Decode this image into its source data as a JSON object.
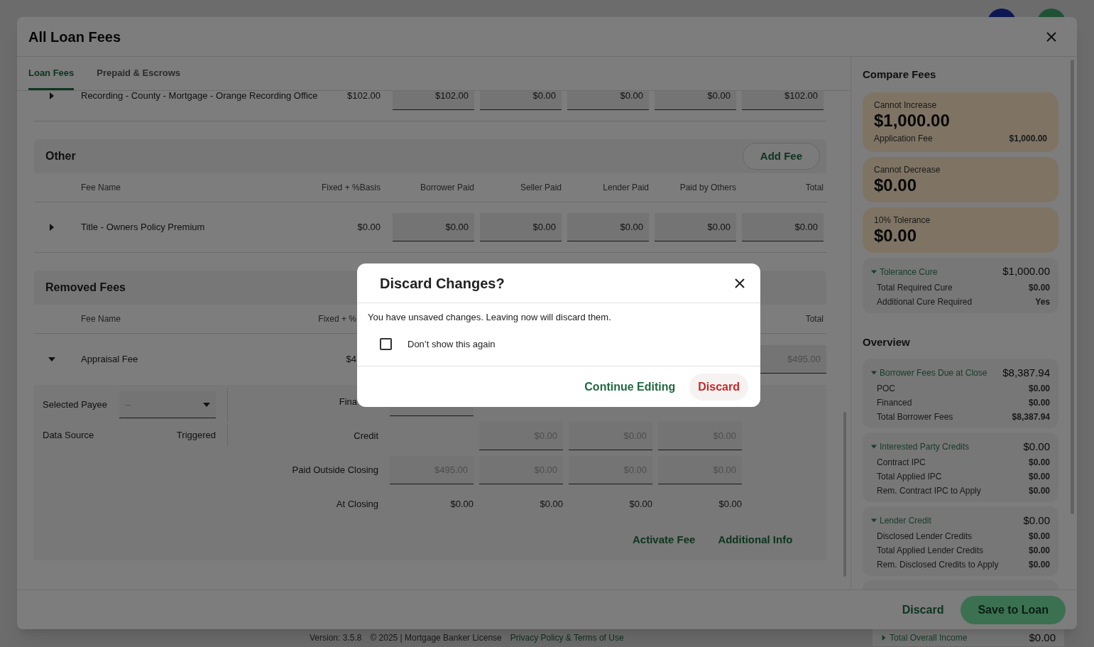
{
  "background_page": {
    "footer_texts": [
      "Version: 3.5.8",
      "© 2025 | Mortgage Banker License"
    ],
    "footer_link": "Privacy Policy & Terms of Use",
    "overview_row": {
      "label": "Total Overall Income",
      "value": "$0.00",
      "expanded": false
    }
  },
  "modal": {
    "title": "All Loan Fees",
    "tabs": [
      {
        "label": "Loan Fees",
        "selected": true
      },
      {
        "label": "Prepaid & Escrows",
        "selected": false
      }
    ],
    "top_row": {
      "name": "Recording - County - Mortgage - Orange Recording Office",
      "fixed": "$102.00",
      "expanded": false,
      "fields": [
        "$102.00",
        "$0.00",
        "$0.00",
        "$0.00",
        "$102.00"
      ]
    },
    "other_section": {
      "title": "Other",
      "add_button": "Add Fee",
      "columns": [
        "Fee Name",
        "Fixed + %Basis",
        "Borrower Paid",
        "Seller Paid",
        "Lender Paid",
        "Paid by Others",
        "Total"
      ],
      "rows": [
        {
          "name": "Title - Owners Policy Premium",
          "fixed": "$0.00",
          "expanded": false,
          "fields": [
            "$0.00",
            "$0.00",
            "$0.00",
            "$0.00",
            "$0.00"
          ]
        }
      ]
    },
    "removed_section": {
      "title": "Removed Fees",
      "columns": {
        "fee_name": "Fee Name",
        "fixed": "Fixed + %",
        "total": "Total"
      },
      "row": {
        "name": "Appraisal Fee",
        "fixed": "$4",
        "expanded": true,
        "total": {
          "value": "$495.00",
          "disabled": true
        }
      },
      "details": {
        "payee": {
          "label": "Selected Payee",
          "value": "--"
        },
        "data_source": {
          "label": "Data Source",
          "value": "Triggered"
        },
        "rows": [
          {
            "label": "Fina",
            "covered_by_dialog": true,
            "cells": [
              {
                "kind": "field"
              }
            ]
          },
          {
            "label": "Credit",
            "cells": [
              {
                "kind": "empty"
              },
              {
                "kind": "field",
                "value": "$0.00",
                "disabled": true
              },
              {
                "kind": "field",
                "value": "$0.00",
                "disabled": true
              },
              {
                "kind": "field",
                "value": "$0.00",
                "disabled": true
              }
            ]
          },
          {
            "label": "Paid Outside Closing",
            "cells": [
              {
                "kind": "field",
                "value": "$495.00",
                "disabled": true
              },
              {
                "kind": "field",
                "value": "$0.00",
                "disabled": true
              },
              {
                "kind": "field",
                "value": "$0.00",
                "disabled": true
              },
              {
                "kind": "field",
                "value": "$0.00",
                "disabled": true
              }
            ]
          },
          {
            "label": "At Closing",
            "cells": [
              {
                "kind": "text",
                "value": "$0.00"
              },
              {
                "kind": "text",
                "value": "$0.00"
              },
              {
                "kind": "text",
                "value": "$0.00"
              },
              {
                "kind": "text",
                "value": "$0.00"
              }
            ]
          }
        ],
        "links": [
          "Activate Fee",
          "Additional Info"
        ]
      }
    },
    "compare_fees": {
      "title": "Compare Fees",
      "tolerance_cards": [
        {
          "label": "Cannot Increase",
          "amount": "$1,000.00",
          "lines": [
            {
              "label": "Application Fee",
              "value": "$1,000.00"
            }
          ]
        },
        {
          "label": "Cannot Decrease",
          "amount": "$0.00"
        },
        {
          "label": "10% Tolerance",
          "amount": "$0.00"
        }
      ],
      "cure_card": {
        "title": "Tolerance Cure",
        "amount": "$1,000.00",
        "expanded": true,
        "lines": [
          {
            "label": "Total Required Cure",
            "value": "$0.00"
          },
          {
            "label": "Additional Cure Required",
            "value": "Yes"
          }
        ]
      }
    },
    "overview": {
      "title": "Overview",
      "cards": [
        {
          "title": "Borrower Fees Due at Close",
          "amount": "$8,387.94",
          "expanded": true,
          "lines": [
            {
              "label": "POC",
              "value": "$0.00"
            },
            {
              "label": "Financed",
              "value": "$0.00"
            },
            {
              "label": "Total Borrower Fees",
              "value": "$8,387.94"
            }
          ]
        },
        {
          "title": "Interested Party Credits",
          "amount": "$0.00",
          "expanded": true,
          "lines": [
            {
              "label": "Contract IPC",
              "value": "$0.00"
            },
            {
              "label": "Total Applied IPC",
              "value": "$0.00"
            },
            {
              "label": "Rem. Contract IPC to Apply",
              "value": "$0.00"
            }
          ]
        },
        {
          "title": "Lender Credit",
          "amount": "$0.00",
          "expanded": true,
          "lines": [
            {
              "label": "Disclosed Lender Credits",
              "value": "$0.00"
            },
            {
              "label": "Total Applied Lender Credits",
              "value": "$0.00"
            },
            {
              "label": "Rem. Disclosed Credits to Apply",
              "value": "$0.00"
            }
          ]
        }
      ]
    },
    "footer": {
      "discard": "Discard",
      "save": "Save to Loan"
    }
  },
  "dialog": {
    "title": "Discard Changes?",
    "message": "You have unsaved changes. Leaving now will discard them.",
    "checkbox": {
      "label": "Don’t show this again",
      "checked": false
    },
    "continue_button": "Continue Editing",
    "discard_button": "Discard"
  }
}
